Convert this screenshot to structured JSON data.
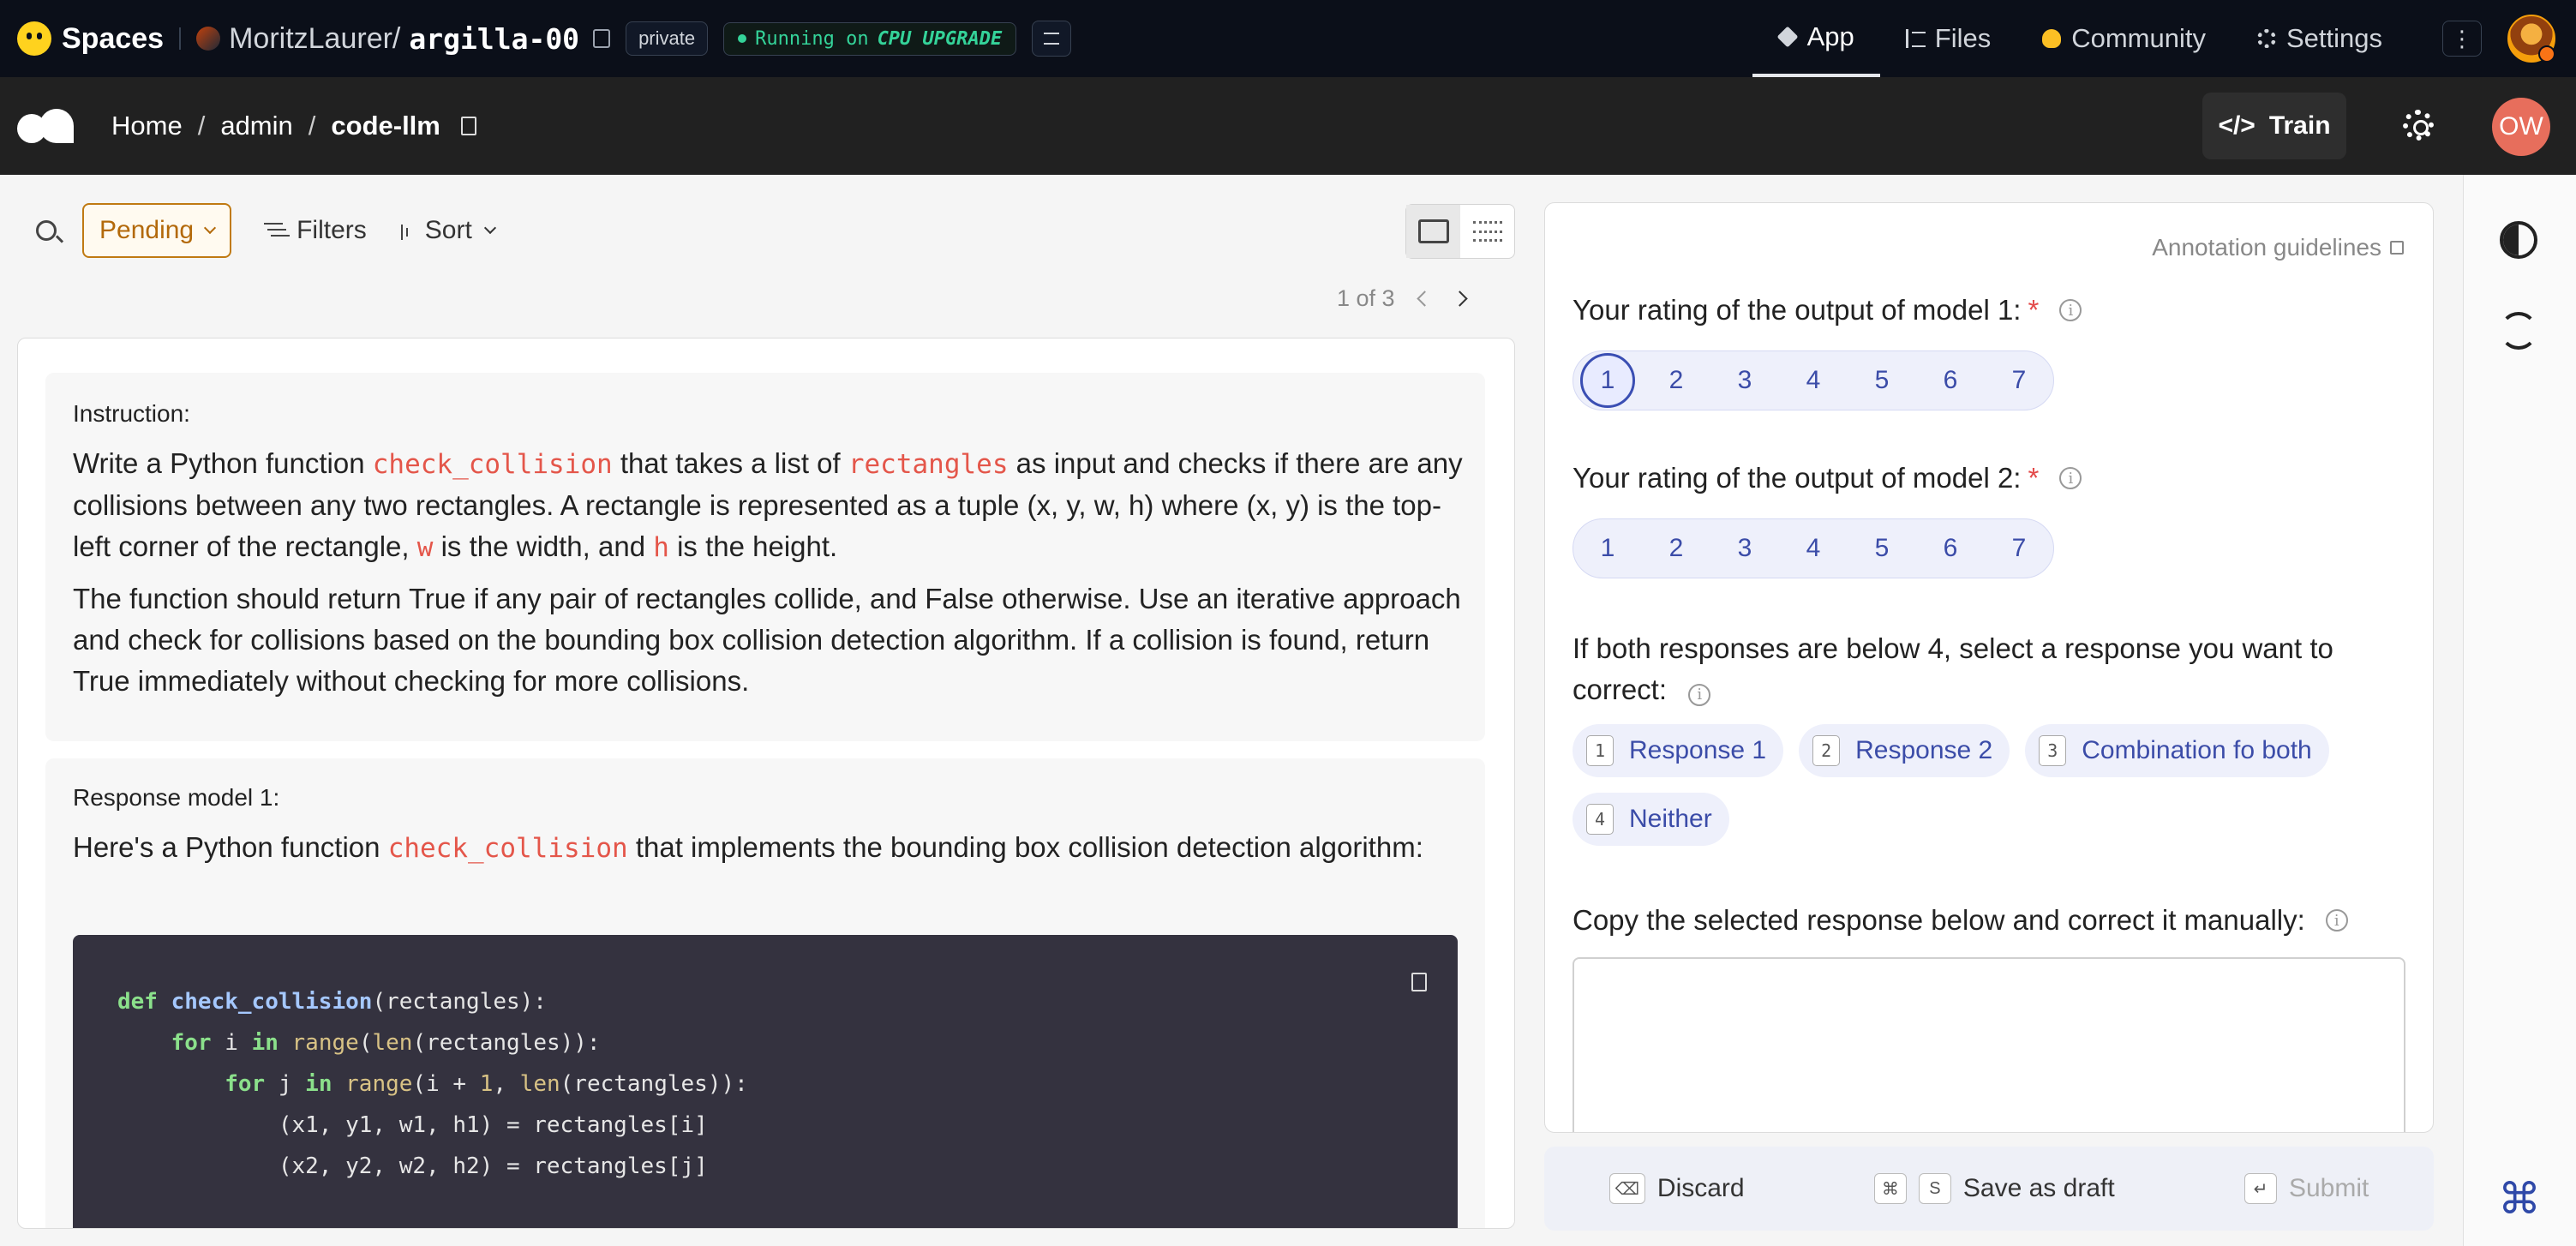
{
  "hf": {
    "brand": "Spaces",
    "owner": "MoritzLaurer/",
    "repo": "argilla-00",
    "visibility": "private",
    "status_prefix": "Running on",
    "status_hw": "CPU UPGRADE",
    "tabs": [
      {
        "label": "App",
        "icon": "cube-icon"
      },
      {
        "label": "Files",
        "icon": "files-icon"
      },
      {
        "label": "Community",
        "icon": "community-icon"
      },
      {
        "label": "Settings",
        "icon": "gear-icon"
      }
    ]
  },
  "argilla": {
    "breadcrumb": [
      "Home",
      "admin",
      "code-llm"
    ],
    "train_label": "Train",
    "user_initials": "OW"
  },
  "toolbar": {
    "status_filter": "Pending",
    "filters_label": "Filters",
    "sort_label": "Sort"
  },
  "pager": {
    "text": "1 of 3"
  },
  "record": {
    "instruction_title": "Instruction:",
    "instruction": {
      "p1_a": "Write a Python function ",
      "p1_code1": "check_collision",
      "p1_b": " that takes a list of ",
      "p1_code2": "rectangles",
      "p1_c": " as input and checks if there are any collisions between any two rectangles. A rectangle is represented as a tuple (x, y, w, h) where (x, y) is the top-left corner of the rectangle, ",
      "p1_code3": "w",
      "p1_d": " is the width, and ",
      "p1_code4": "h",
      "p1_e": " is the height.",
      "p2": "The function should return True if any pair of rectangles collide, and False otherwise. Use an iterative approach and check for collisions based on the bounding box collision detection algorithm. If a collision is found, return True immediately without checking for more collisions."
    },
    "response_title": "Response model 1:",
    "response": {
      "a": "Here's a Python function ",
      "code": "check_collision",
      "b": " that implements the bounding box collision detection algorithm:"
    },
    "code_lines": [
      "def check_collision(rectangles):",
      "    for i in range(len(rectangles)):",
      "        for j in range(i + 1, len(rectangles)):",
      "            (x1, y1, w1, h1) = rectangles[i]",
      "            (x2, y2, w2, h2) = rectangles[j]"
    ]
  },
  "form": {
    "guidelines_label": "Annotation guidelines",
    "q1": "Your rating of the output of model 1:",
    "q2": "Your rating of the output of model 2:",
    "q3": "If both responses are below 4, select a response you want to correct:",
    "q4": "Copy the selected response below and correct it manually:",
    "rating_options": [
      "1",
      "2",
      "3",
      "4",
      "5",
      "6",
      "7"
    ],
    "q1_selected": "1",
    "choices": [
      {
        "key": "1",
        "label": "Response 1"
      },
      {
        "key": "2",
        "label": "Response 2"
      },
      {
        "key": "3",
        "label": "Combination fo both"
      },
      {
        "key": "4",
        "label": "Neither"
      }
    ],
    "required_mark": "*"
  },
  "footer": {
    "discard": "Discard",
    "save": "Save as draft",
    "submit": "Submit",
    "save_keys": [
      "⌘",
      "S"
    ]
  },
  "colors": {
    "accent": "#3b4ca8",
    "pending": "#b3690a",
    "running": "#34d399",
    "avatar_bg": "#e76e5c"
  }
}
